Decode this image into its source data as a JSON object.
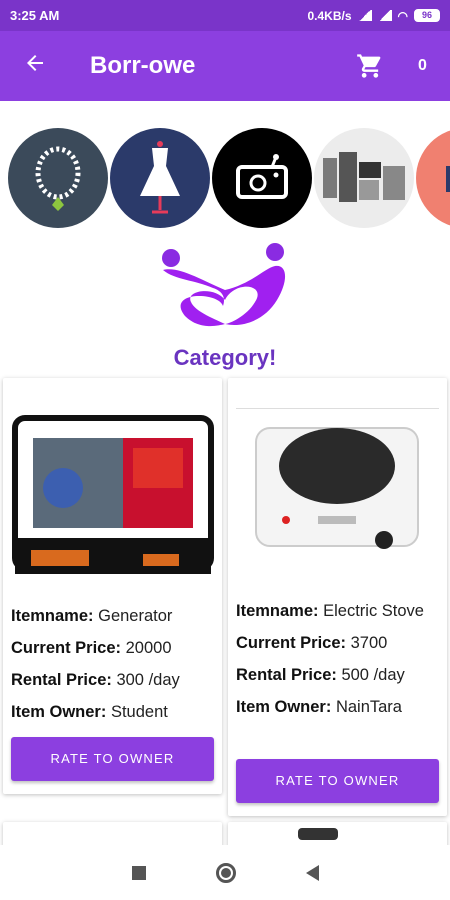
{
  "status": {
    "time": "3:25 AM",
    "speed": "0.4KB/s",
    "battery": "96"
  },
  "appbar": {
    "title": "Borr-owe",
    "cart_count": "0"
  },
  "categories": [
    {
      "icon": "necklace-icon",
      "bg": "#3b4a5a"
    },
    {
      "icon": "dress-icon",
      "bg": "#2b3a6a"
    },
    {
      "icon": "radio-icon",
      "bg": "#000000"
    },
    {
      "icon": "appliances-icon",
      "bg": "#e8e8e8"
    },
    {
      "icon": "bed-icon",
      "bg": "#f08070"
    }
  ],
  "heading": "Category!",
  "items": [
    {
      "name_label": "Itemname:",
      "name": " Generator",
      "price_label": "Current Price:",
      "price": " 20000",
      "rental_label": "Rental Price:",
      "rental": " 300 /day",
      "owner_label": "Item Owner:",
      "owner": " Student",
      "button": "RATE TO OWNER"
    },
    {
      "name_label": "Itemname:",
      "name": " Electric Stove",
      "price_label": "Current Price:",
      "price": " 3700",
      "rental_label": "Rental Price:",
      "rental": " 500 /day",
      "owner_label": "Item Owner:",
      "owner": " NainTara",
      "button": "RATE TO OWNER"
    }
  ],
  "colors": {
    "primary": "#8c3fe0",
    "statusbar": "#7a34c9",
    "heading": "#6a34c0"
  }
}
